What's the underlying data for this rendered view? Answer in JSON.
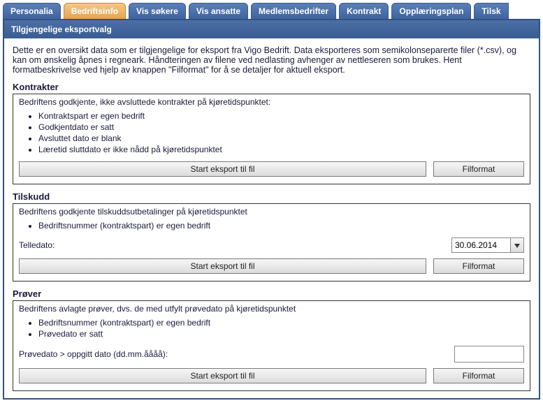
{
  "tabs": {
    "personalia": "Personalia",
    "bedriftsinfo": "Bedriftsinfo",
    "vis_sokere": "Vis søkere",
    "vis_ansatte": "Vis ansatte",
    "medlemsbedrifter": "Medlemsbedrifter",
    "kontrakt": "Kontrakt",
    "opplaeringsplan": "Opplæringsplan",
    "tilsk_trunc": "Tilsk"
  },
  "panel": {
    "header": "Tilgjengelige eksportvalg",
    "intro": "Dette er en oversikt data som er tilgjengelige for eksport fra Vigo Bedrift. Data eksporteres som semikolonseparerte filer (*.csv), og kan om ønskelig åpnes i regneark. Håndteringen av filene ved nedlasting avhenger av nettleseren som brukes. Hent formatbeskrivelse ved hjelp av knappen \"Filformat\" for å se detaljer for aktuell eksport."
  },
  "kontrakter": {
    "title": "Kontrakter",
    "desc": "Bedriftens godkjente, ikke avsluttede kontrakter på kjøretidspunktet:",
    "items": {
      "i1": "Kontraktspart er egen bedrift",
      "i2": "Godkjentdato er satt",
      "i3": "Avsluttet dato er blank",
      "i4": "Læretid sluttdato er ikke nådd på kjøretidspunktet"
    },
    "btn_start": "Start eksport til fil",
    "btn_format": "Filformat"
  },
  "tilskudd": {
    "title": "Tilskudd",
    "desc": "Bedriftens godkjente tilskuddsutbetalinger på kjøretidspunktet",
    "items": {
      "i1": "Bedriftsnummer (kontraktspart) er egen bedrift"
    },
    "telledato_label": "Telledato:",
    "telledato_value": "30.06.2014",
    "btn_start": "Start eksport til fil",
    "btn_format": "Filformat"
  },
  "prover": {
    "title": "Prøver",
    "desc": "Bedriftens avlagte prøver, dvs. de med utfylt prøvedato på kjøretidspunktet",
    "items": {
      "i1": "Bedriftsnummer (kontraktspart) er egen bedrift",
      "i2": "Prøvedato er satt"
    },
    "provedato_label": "Prøvedato > oppgitt dato (dd.mm.åååå):",
    "provedato_value": "",
    "btn_start": "Start eksport til fil",
    "btn_format": "Filformat"
  }
}
